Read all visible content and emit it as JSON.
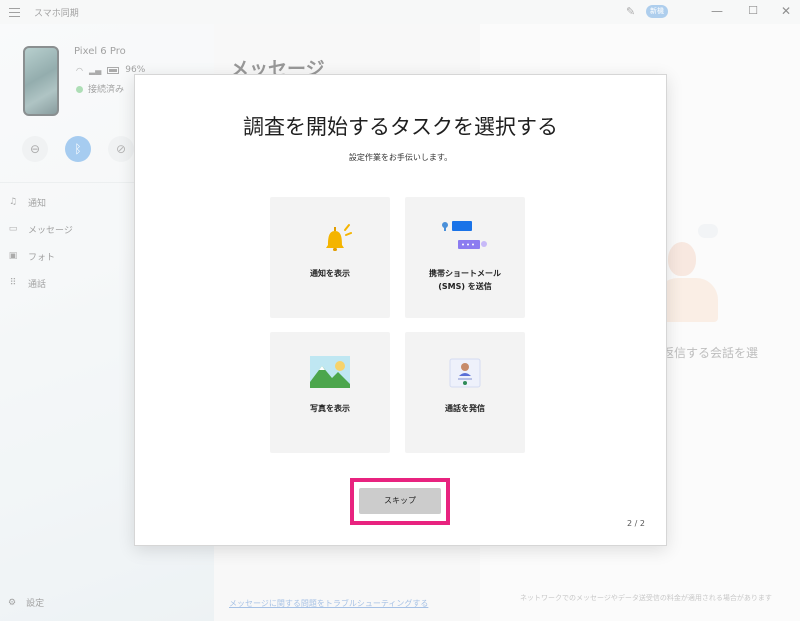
{
  "window": {
    "app_title": "スマホ同期",
    "new_badge": "新機",
    "minimize": "—",
    "maximize": "☐",
    "close": "✕"
  },
  "device": {
    "name": "Pixel 6 Pro",
    "battery": "96%",
    "status": "接続済み"
  },
  "sidebar": {
    "items": [
      {
        "label": "通知",
        "icon": "bell-icon"
      },
      {
        "label": "メッセージ",
        "icon": "message-icon"
      },
      {
        "label": "フォト",
        "icon": "photo-icon"
      },
      {
        "label": "通話",
        "icon": "dialpad-icon"
      }
    ],
    "settings_label": "設定"
  },
  "main": {
    "heading": "メッセージ",
    "select_conversation": "返信する会話を選",
    "troubleshoot_link": "メッセージに関する問題をトラブルシューティングする",
    "footer_note": "ネットワークでのメッセージやデータ送受信の料金が適用される場合があります"
  },
  "dialog": {
    "title": "調査を開始するタスクを選択する",
    "subtitle": "設定作業をお手伝いします。",
    "cards": [
      {
        "label": "通知を表示",
        "icon": "bell-icon"
      },
      {
        "label": "携帯ショートメール\n(SMS) を送信",
        "icon": "sms-chat-icon"
      },
      {
        "label": "写真を表示",
        "icon": "photo-landscape-icon"
      },
      {
        "label": "通話を発信",
        "icon": "call-contact-icon"
      }
    ],
    "skip_label": "スキップ",
    "page_indicator": "2 / 2"
  },
  "colors": {
    "accent": "#5da3e4",
    "highlight": "#e8237f",
    "connected": "#6cc47b"
  }
}
